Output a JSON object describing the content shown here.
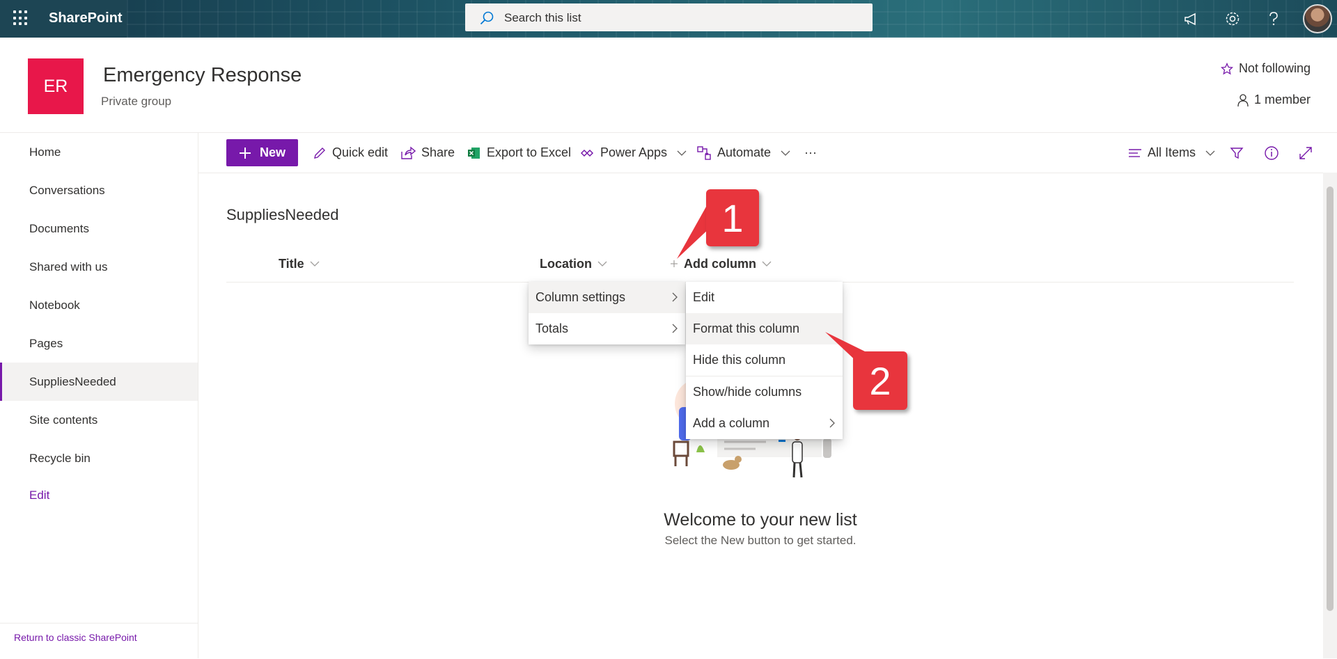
{
  "suitebar": {
    "app_name": "SharePoint",
    "search_placeholder": "Search this list",
    "icons": [
      "waffle-icon",
      "megaphone-icon",
      "gear-icon",
      "help-icon"
    ]
  },
  "site": {
    "logo_initials": "ER",
    "logo_color": "#e8174a",
    "title": "Emergency Response",
    "subtitle": "Private group",
    "follow_label": "Not following",
    "members_label": "1 member"
  },
  "nav": {
    "items": [
      {
        "label": "Home"
      },
      {
        "label": "Conversations"
      },
      {
        "label": "Documents"
      },
      {
        "label": "Shared with us"
      },
      {
        "label": "Notebook"
      },
      {
        "label": "Pages"
      },
      {
        "label": "SuppliesNeeded",
        "selected": true
      },
      {
        "label": "Site contents"
      },
      {
        "label": "Recycle bin"
      }
    ],
    "edit_label": "Edit",
    "classic_label": "Return to classic SharePoint"
  },
  "commandbar": {
    "new_label": "New",
    "quick_edit": "Quick edit",
    "share": "Share",
    "export": "Export to Excel",
    "power_apps": "Power Apps",
    "automate": "Automate",
    "more": "···",
    "view_label": "All Items"
  },
  "list": {
    "title": "SuppliesNeeded",
    "columns": [
      "Title",
      "Location",
      "Add column"
    ]
  },
  "column_menu": {
    "items": [
      "Column settings",
      "Totals"
    ]
  },
  "submenu": {
    "items": [
      "Edit",
      "Format this column",
      "Hide this column",
      "Show/hide columns",
      "Add a column"
    ]
  },
  "callouts": [
    "1",
    "2"
  ],
  "empty_state": {
    "heading": "Welcome to your new list",
    "subtext": "Select the New button to get started."
  },
  "colors": {
    "accent": "#7719aa",
    "callout": "#e8353d"
  }
}
